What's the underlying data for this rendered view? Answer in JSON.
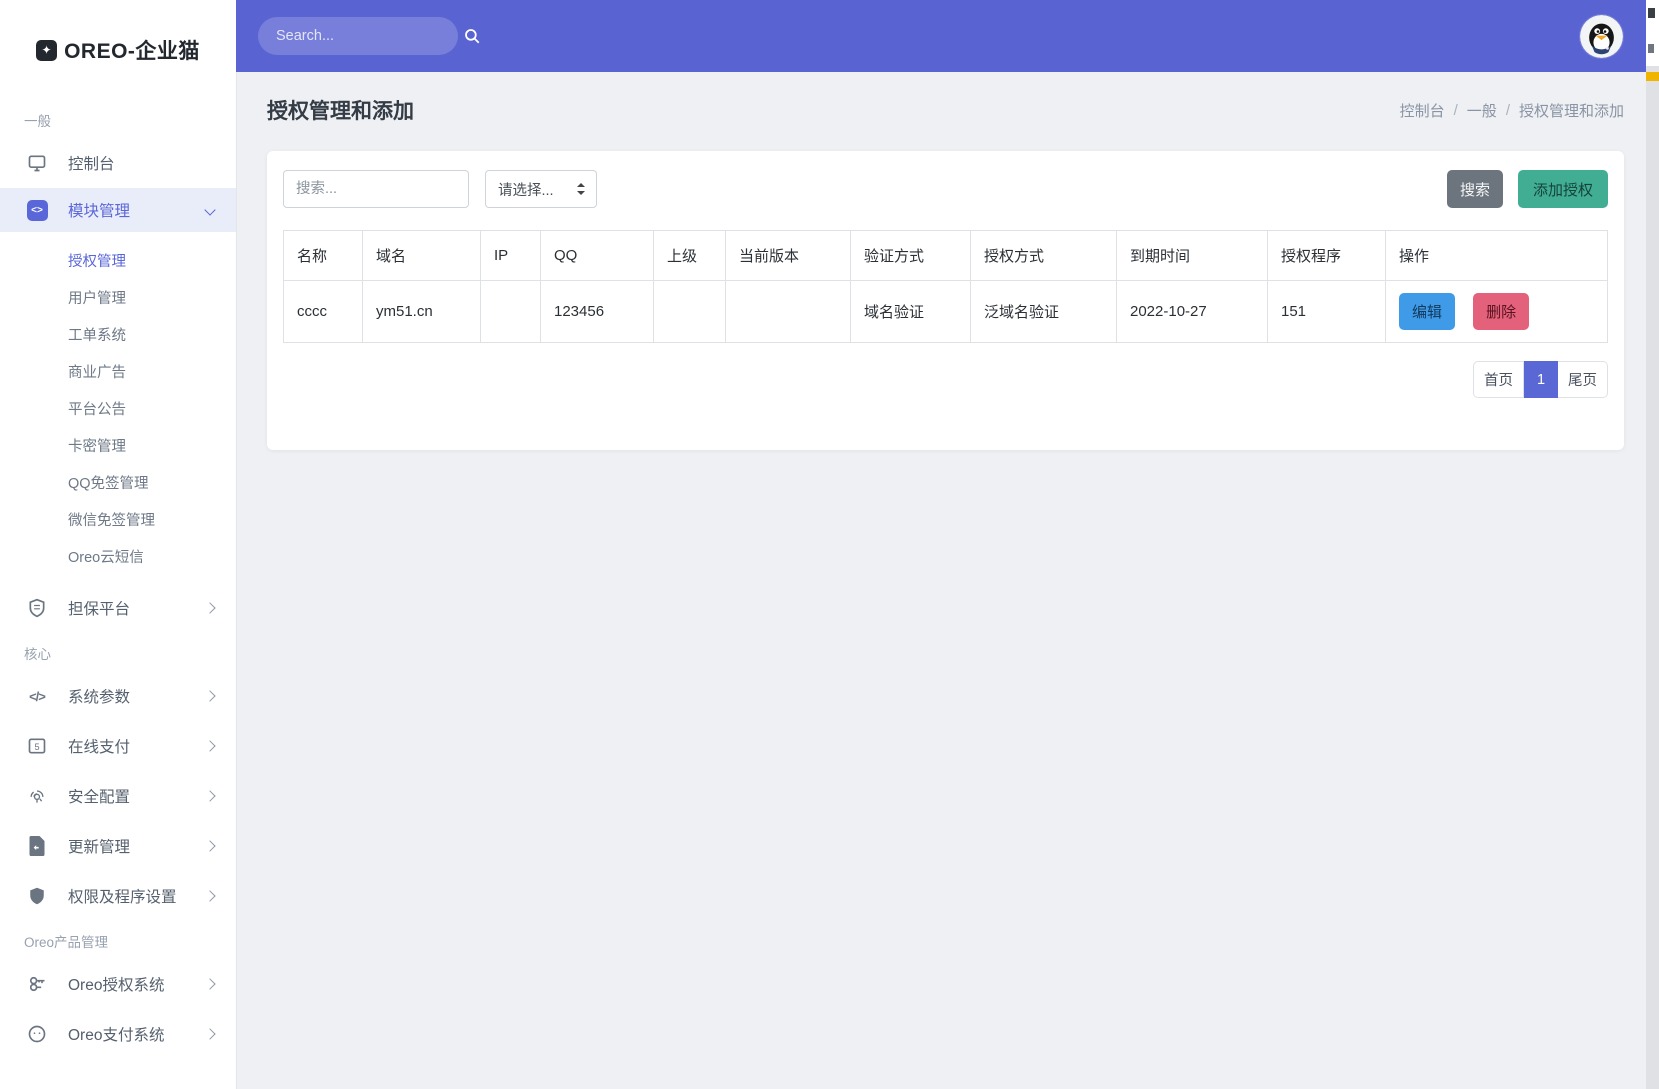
{
  "colors": {
    "topbar": "#5a63d2",
    "primary": "#5a67d8",
    "success": "#41ae94",
    "info": "#3f9be8",
    "danger": "#e4617b",
    "secondary": "#6c757d"
  },
  "brand": {
    "name": "OREO-企业猫",
    "badge_glyph": "✦"
  },
  "topbar": {
    "search_placeholder": "Search..."
  },
  "sidebar": {
    "section_general": "一般",
    "console": {
      "label": "控制台"
    },
    "modules": {
      "label": "模块管理",
      "icon_glyph": "<>"
    },
    "submenu": [
      {
        "label": "授权管理"
      },
      {
        "label": "用户管理"
      },
      {
        "label": "工单系统"
      },
      {
        "label": "商业广告"
      },
      {
        "label": "平台公告"
      },
      {
        "label": "卡密管理"
      },
      {
        "label": "QQ免签管理"
      },
      {
        "label": "微信免签管理"
      },
      {
        "label": "Oreo云短信"
      }
    ],
    "danbao": {
      "label": "担保平台"
    },
    "section_core": "核心",
    "core_items": [
      {
        "label": "系统参数",
        "icon_glyph": "</>"
      },
      {
        "label": "在线支付"
      },
      {
        "label": "安全配置"
      },
      {
        "label": "更新管理"
      },
      {
        "label": "权限及程序设置"
      }
    ],
    "section_oreo": "Oreo产品管理",
    "oreo_items": [
      {
        "label": "Oreo授权系统"
      },
      {
        "label": "Oreo支付系统"
      }
    ]
  },
  "page": {
    "title": "授权管理和添加",
    "breadcrumb": {
      "0": "控制台",
      "1": "一般",
      "2": "授权管理和添加",
      "separator": "/"
    }
  },
  "filters": {
    "search_placeholder": "搜索...",
    "select_value": "请选择...",
    "search_button": "搜索",
    "add_button": "添加授权"
  },
  "table": {
    "headers": [
      "名称",
      "域名",
      "IP",
      "QQ",
      "上级",
      "当前版本",
      "验证方式",
      "授权方式",
      "到期时间",
      "授权程序",
      "操作"
    ],
    "rows": [
      {
        "cells": [
          "cccc",
          "ym51.cn",
          "",
          "123456",
          "",
          "",
          "域名验证",
          "泛域名验证",
          "2022-10-27",
          "151"
        ],
        "actions": {
          "edit": "编辑",
          "delete": "删除"
        }
      }
    ]
  },
  "pagination": {
    "first": "首页",
    "current": "1",
    "last": "尾页"
  }
}
